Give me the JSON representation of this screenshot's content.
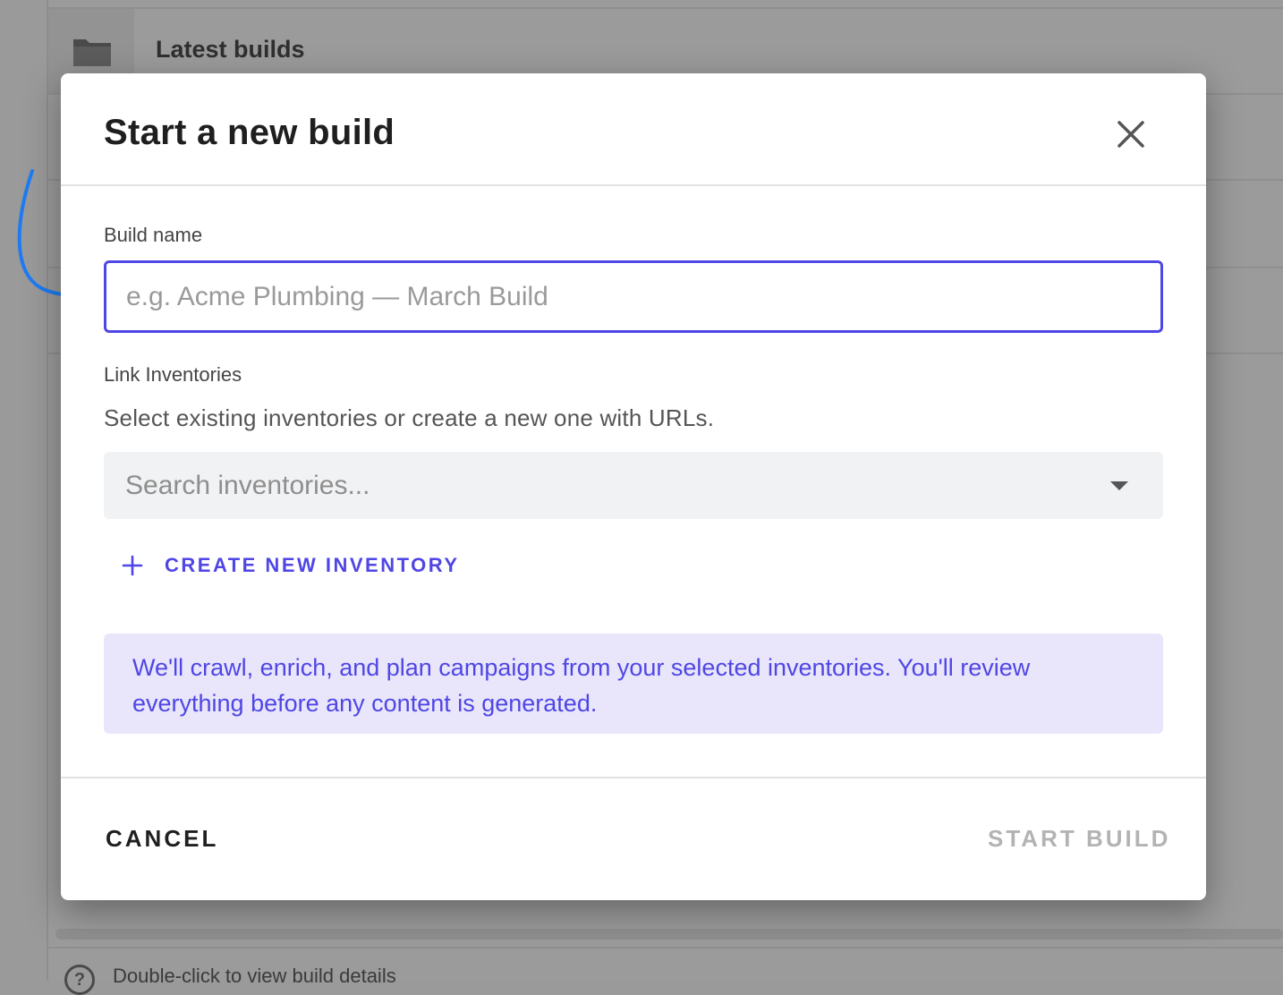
{
  "background": {
    "section_title": "Latest builds",
    "footer_hint": "Double-click to view build details",
    "folder_icon": "folder-icon",
    "help_icon": "help-circle-icon"
  },
  "modal": {
    "title": "Start a new build",
    "close_icon": "close-icon",
    "build_name": {
      "label": "Build name",
      "value": "",
      "placeholder": "e.g. Acme Plumbing — March Build"
    },
    "link_inventories": {
      "label": "Link Inventories",
      "helper": "Select existing inventories or create a new one with URLs.",
      "search_placeholder": "Search inventories...",
      "dropdown_icon": "caret-down-icon"
    },
    "create_button": {
      "icon": "plus-icon",
      "label": "CREATE NEW INVENTORY"
    },
    "info_message": "We'll crawl, enrich, and plan campaigns from your selected inventories. You'll review everything before any content is generated.",
    "footer": {
      "cancel_label": "CANCEL",
      "start_label": "START BUILD"
    }
  },
  "colors": {
    "accent": "#4f46e5",
    "info_bg": "#e9e6fb",
    "disabled_text": "#b3b3b3",
    "annotation_arrow": "#1e7bf2",
    "overlay": "#9b9b9b"
  }
}
